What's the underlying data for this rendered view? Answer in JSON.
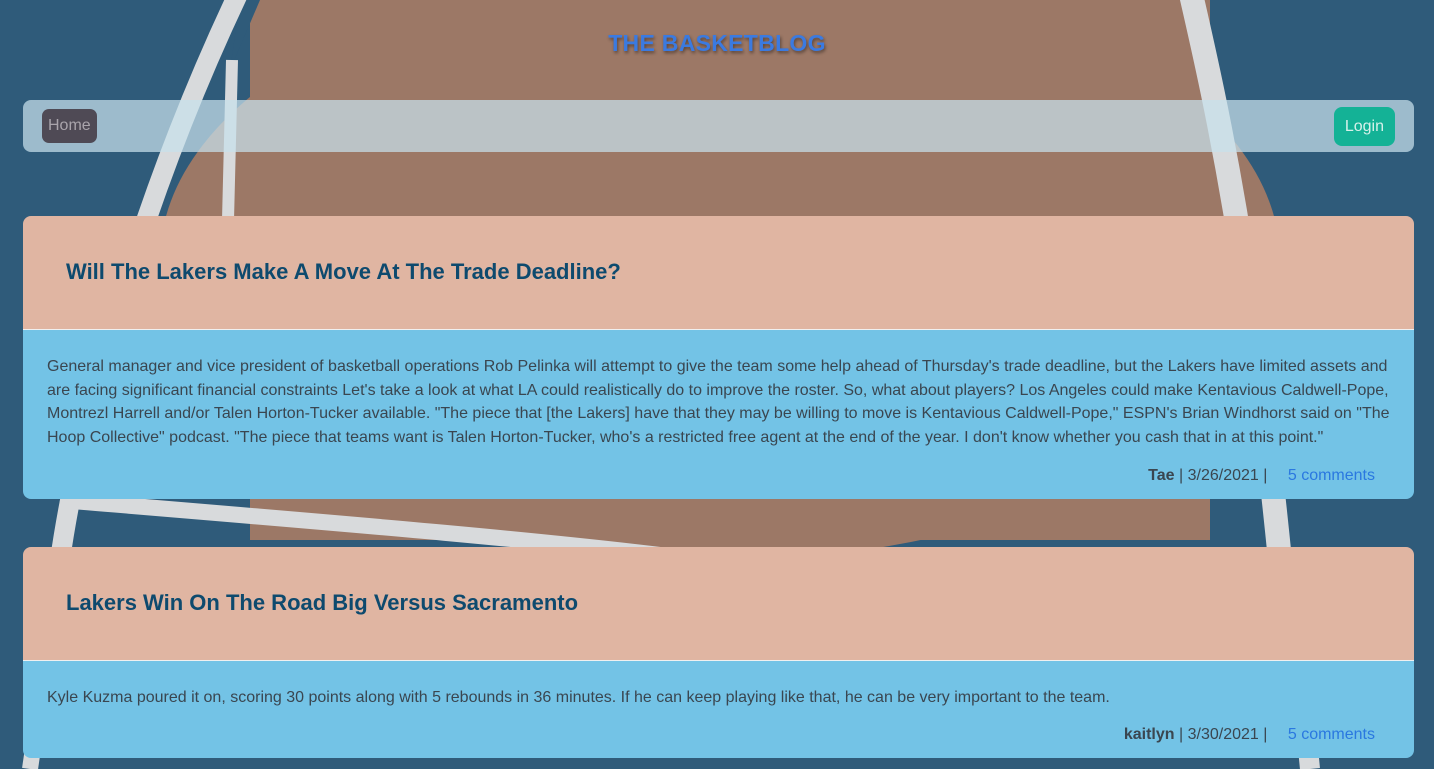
{
  "site": {
    "title": "THE BASKETBLOG"
  },
  "nav": {
    "home_label": "Home",
    "login_label": "Login"
  },
  "posts": [
    {
      "title": "Will The Lakers Make A Move At The Trade Deadline?",
      "content": "General manager and vice president of basketball operations Rob Pelinka will attempt to give the team some help ahead of Thursday's trade deadline, but the Lakers have limited assets and are facing significant financial constraints Let's take a look at what LA could realistically do to improve the roster. So, what about players? Los Angeles could make Kentavious Caldwell-Pope, Montrezl Harrell and/or Talen Horton-Tucker available. \"The piece that [the Lakers] have that they may be willing to move is Kentavious Caldwell-Pope,\" ESPN's Brian Windhorst said on \"The Hoop Collective\" podcast. \"The piece that teams want is Talen Horton-Tucker, who's a restricted free agent at the end of the year. I don't know whether you cash that in at this point.\"",
      "author": "Tae",
      "date": "3/26/2021",
      "comments": "5 comments"
    },
    {
      "title": "Lakers Win On The Road Big Versus Sacramento",
      "content": "Kyle Kuzma poured it on, scoring 30 points along with 5 rebounds in 36 minutes. If he can keep playing like that, he can be very important to the team.",
      "author": "kaitlyn",
      "date": "3/30/2021",
      "comments": "5 comments"
    }
  ],
  "colors": {
    "title": "#3b7ae0",
    "post_header": "#e0b5a2",
    "post_body": "#73c3e6",
    "post_title": "#0e4a6e",
    "login_button": "#14b296",
    "home_button": "#4f4a55",
    "comments_link": "#2a78e0"
  }
}
